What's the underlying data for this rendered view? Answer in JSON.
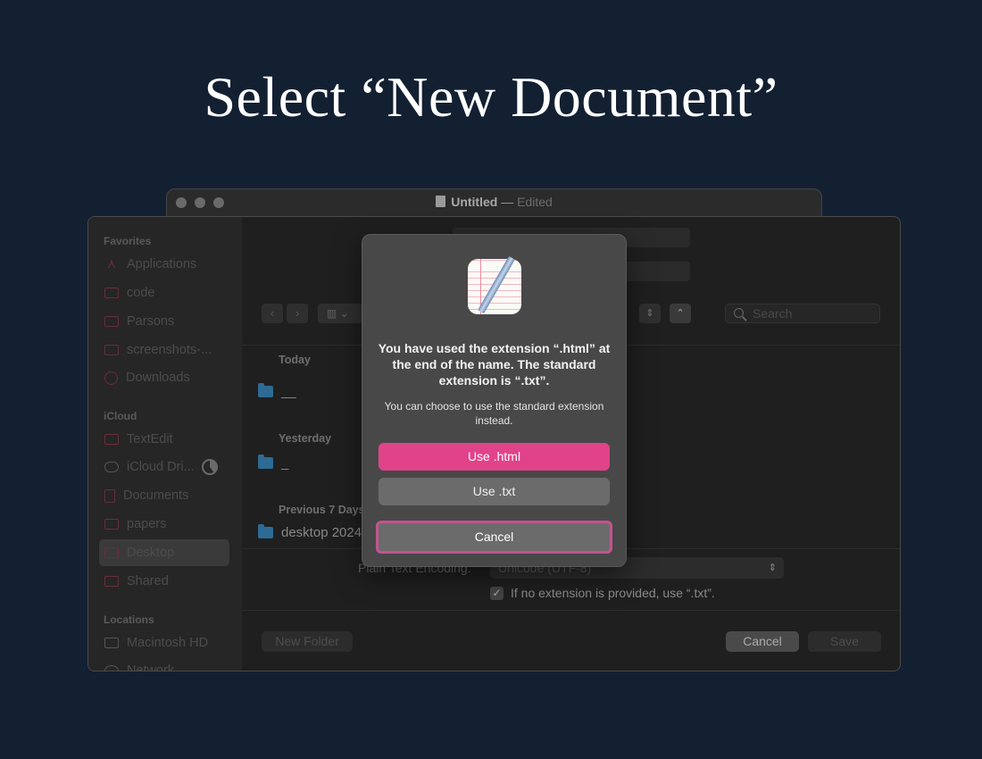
{
  "headline": "Select “New Document”",
  "window": {
    "title": "Untitled",
    "separator": "—",
    "status": "Edited"
  },
  "sidebar": {
    "sections": [
      {
        "title": "Favorites"
      },
      {
        "title": "iCloud"
      },
      {
        "title": "Locations"
      }
    ],
    "items": [
      {
        "label": "Applications",
        "icon": "applications-icon"
      },
      {
        "label": "code",
        "icon": "folder-icon"
      },
      {
        "label": "Parsons",
        "icon": "folder-icon"
      },
      {
        "label": "screenshots-...",
        "icon": "folder-icon"
      },
      {
        "label": "Downloads",
        "icon": "downloads-icon"
      },
      {
        "label": "TextEdit",
        "icon": "folder-icon"
      },
      {
        "label": "iCloud Dri...",
        "icon": "cloud-icon"
      },
      {
        "label": "Documents",
        "icon": "document-icon"
      },
      {
        "label": "papers",
        "icon": "folder-icon"
      },
      {
        "label": "Desktop",
        "icon": "desktop-icon",
        "selected": true
      },
      {
        "label": "Shared",
        "icon": "shared-folder-icon"
      },
      {
        "label": "Macintosh HD",
        "icon": "disk-icon"
      },
      {
        "label": "Network",
        "icon": "network-icon"
      }
    ]
  },
  "toolbar": {
    "search_placeholder": "Search"
  },
  "file_list": {
    "groups": [
      {
        "label": "Today",
        "files": [
          {
            "name": "__"
          }
        ]
      },
      {
        "label": "Yesterday",
        "files": [
          {
            "name": "_"
          }
        ]
      },
      {
        "label": "Previous 7 Days",
        "files": [
          {
            "name": "desktop 2024"
          }
        ]
      }
    ]
  },
  "options": {
    "encoding_label": "Plain Text Encoding:",
    "encoding_value": "Unicode (UTF-8)",
    "extension_checkbox_label": "If no extension is provided, use “.txt”.",
    "extension_checkbox_checked": true
  },
  "footer": {
    "new_folder": "New Folder",
    "cancel": "Cancel",
    "save": "Save"
  },
  "alert": {
    "title": "You have used the extension “.html” at the end of the name. The standard extension is “.txt”.",
    "message": "You can choose to use the standard extension instead.",
    "use_html": "Use .html",
    "use_txt": "Use .txt",
    "cancel": "Cancel",
    "accent_color": "#e1438a"
  }
}
